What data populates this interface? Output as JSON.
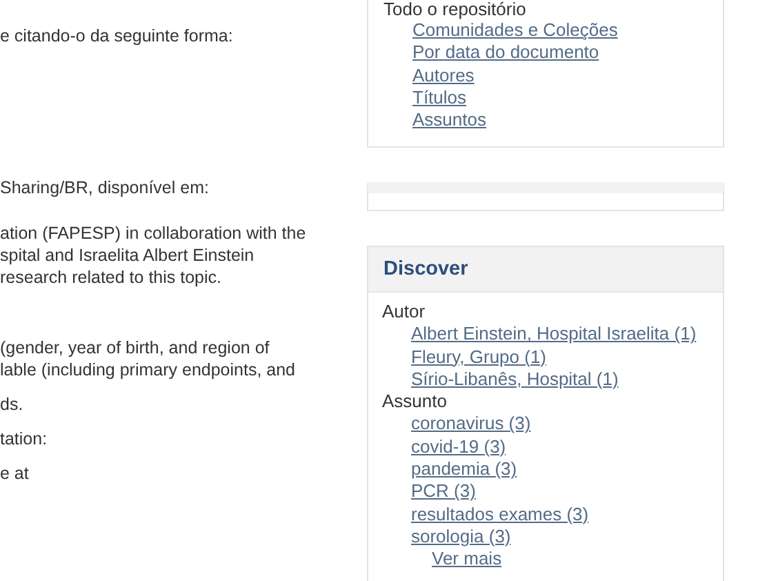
{
  "main_text": {
    "paragraphs": [
      [
        "e citando-o da seguinte forma:"
      ],
      [
        "Sharing/BR, disponível em:"
      ],
      [
        "ation (FAPESP) in collaboration with the",
        "spital and Israelita Albert Einstein",
        "research related to this topic."
      ],
      [
        "(gender, year of birth, and region of",
        "lable (including primary endpoints, and"
      ],
      [
        "ds."
      ],
      [
        "tation:"
      ],
      [
        "e at"
      ]
    ]
  },
  "browse": {
    "heading": "Todo o repositório",
    "links": [
      "Comunidades e Coleções",
      "Por data do documento",
      "Autores",
      "Títulos",
      "Assuntos"
    ]
  },
  "discover": {
    "title": "Discover",
    "facets": [
      {
        "label": "Autor",
        "links": [
          "Albert Einstein, Hospital Israelita (1)",
          "Fleury, Grupo (1)",
          "Sírio-Libanês, Hospital (1)"
        ]
      },
      {
        "label": "Assunto",
        "links": [
          "coronavirus (3)",
          "covid-19 (3)",
          "pandemia (3)",
          "PCR (3)",
          "resultados exames (3)",
          "sorologia (3)"
        ]
      }
    ],
    "more_link": "Ver mais"
  }
}
